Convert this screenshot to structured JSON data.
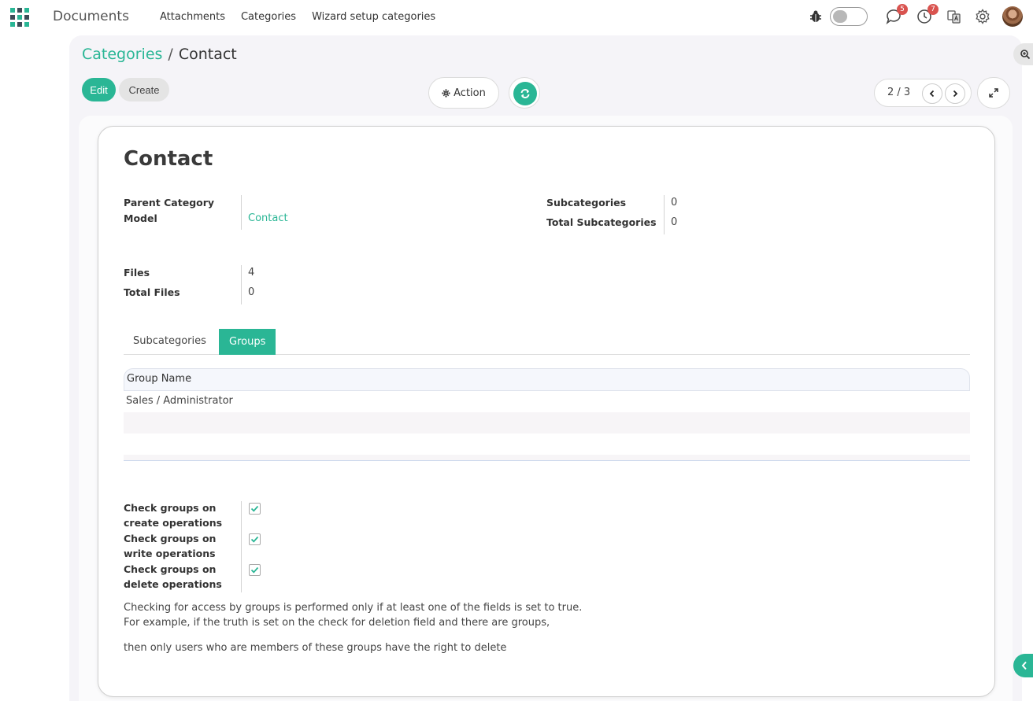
{
  "navbar": {
    "app_name": "Documents",
    "menu": [
      "Attachments",
      "Categories",
      "Wizard setup categories"
    ],
    "messages_count": "5",
    "activities_count": "7",
    "accent_color": "#2ab695"
  },
  "breadcrumb": {
    "parent": "Categories",
    "separator": "/",
    "current": "Contact"
  },
  "toolbar": {
    "edit_label": "Edit",
    "create_label": "Create",
    "action_label": "Action",
    "pager_value": "2 / 3"
  },
  "record": {
    "title": "Contact",
    "parent_category_label": "Parent Category",
    "model_label": "Model",
    "model_value": "Contact",
    "subcategories_label": "Subcategories",
    "subcategories_value": "0",
    "total_subcategories_label": "Total Subcategories",
    "total_subcategories_value": "0",
    "files_label": "Files",
    "files_value": "4",
    "total_files_label": "Total Files",
    "total_files_value": "0"
  },
  "tabs": [
    {
      "label": "Subcategories",
      "active": false
    },
    {
      "label": "Groups",
      "active": true
    }
  ],
  "groups_table": {
    "header": "Group Name",
    "rows": [
      "Sales / Administrator"
    ]
  },
  "checks": {
    "create_label_1": "Check groups on",
    "create_label_2": "create operations",
    "create_value": true,
    "write_label_1": "Check groups on",
    "write_label_2": "write operations",
    "write_value": true,
    "delete_label_1": "Check groups on",
    "delete_label_2": "delete operations",
    "delete_value": true
  },
  "help": {
    "line1": "Checking for access by groups is performed only if at least one of the fields is set to true.",
    "line2": "For example, if the truth is set on the check for deletion field and there are groups,",
    "line3": "then only users who are members of these groups have the right to delete"
  }
}
